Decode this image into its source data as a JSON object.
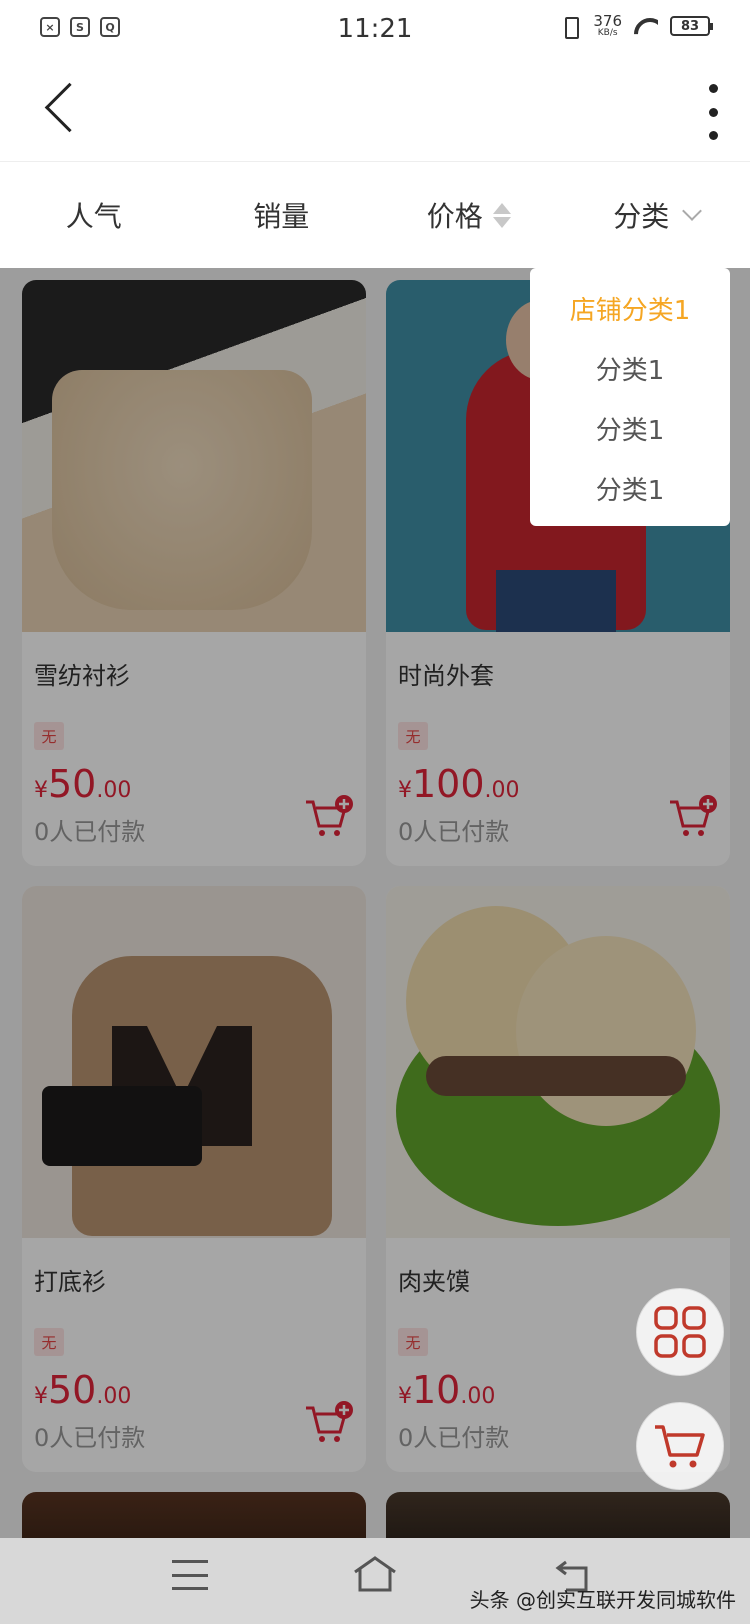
{
  "status_bar": {
    "time": "11:21",
    "speed_value": "376",
    "speed_unit": "KB/s",
    "battery": "83",
    "left_icons": [
      "x-icon",
      "sync-icon",
      "search-box-icon"
    ]
  },
  "nav": {
    "back_icon": "chevron-left-icon",
    "more_icon": "more-vertical-icon"
  },
  "sort_tabs": [
    {
      "label": "人气"
    },
    {
      "label": "销量"
    },
    {
      "label": "价格",
      "icon": "sort-arrows-icon"
    },
    {
      "label": "分类",
      "icon": "chevron-down-icon"
    }
  ],
  "dropdown": {
    "items": [
      {
        "label": "店铺分类1",
        "active": true
      },
      {
        "label": "分类1"
      },
      {
        "label": "分类1"
      },
      {
        "label": "分类1"
      }
    ],
    "active_color": "#f5a623"
  },
  "products": [
    {
      "name": "雪纺衬衫",
      "tag": "无",
      "currency": "¥",
      "price_int": "50",
      "price_dec": ".00",
      "paid": "0人已付款"
    },
    {
      "name": "时尚外套",
      "tag": "无",
      "currency": "¥",
      "price_int": "100",
      "price_dec": ".00",
      "paid": "0人已付款"
    },
    {
      "name": "打底衫",
      "tag": "无",
      "currency": "¥",
      "price_int": "50",
      "price_dec": ".00",
      "paid": "0人已付款"
    },
    {
      "name": "肉夹馍",
      "tag": "无",
      "currency": "¥",
      "price_int": "10",
      "price_dec": ".00",
      "paid": "0人已付款"
    }
  ],
  "colors": {
    "price": "#e0243a",
    "accent_icon": "#c0392b"
  },
  "floating_buttons": [
    "grid-icon",
    "cart-icon"
  ],
  "system_nav": [
    "menu-icon",
    "home-icon",
    "back-icon"
  ],
  "watermark": "头条 @创实互联开发同城软件"
}
